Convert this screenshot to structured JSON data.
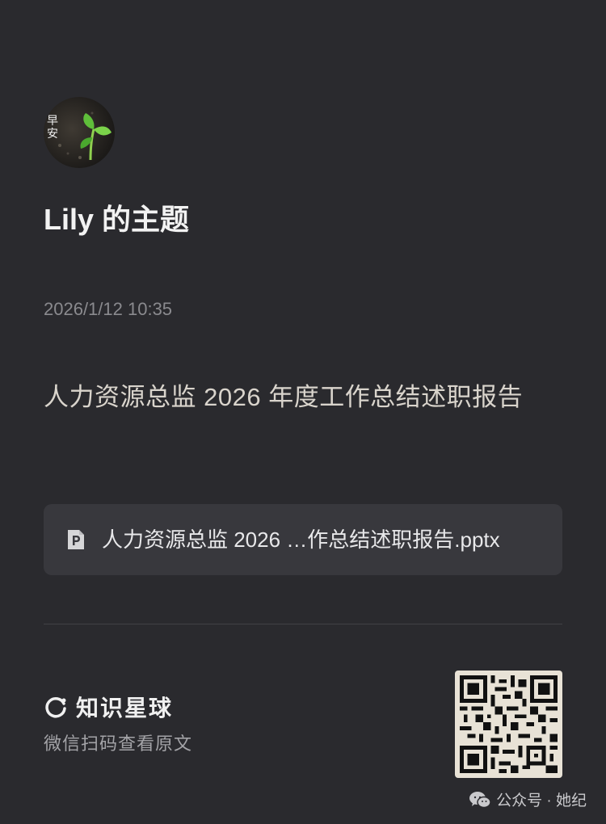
{
  "post": {
    "title": "Lily 的主题",
    "timestamp": "2026/1/12 10:35",
    "description": "人力资源总监 2026 年度工作总结述职报告",
    "attachment": {
      "file_name": "人力资源总监 2026 …作总结述职报告.pptx",
      "icon": "pptx-file-icon"
    },
    "avatar": {
      "icon": "sprout-avatar-icon",
      "text": "早安"
    }
  },
  "brand": {
    "name": "知识星球",
    "icon": "knowledge-planet-icon",
    "subtitle": "微信扫码查看原文"
  },
  "footer": {
    "label": "公众号 · 她纪",
    "icon": "wechat-icon"
  },
  "colors": {
    "background": "#2a2a2e",
    "card_attachment": "#38383d",
    "qr_background": "#e8e2d6"
  }
}
